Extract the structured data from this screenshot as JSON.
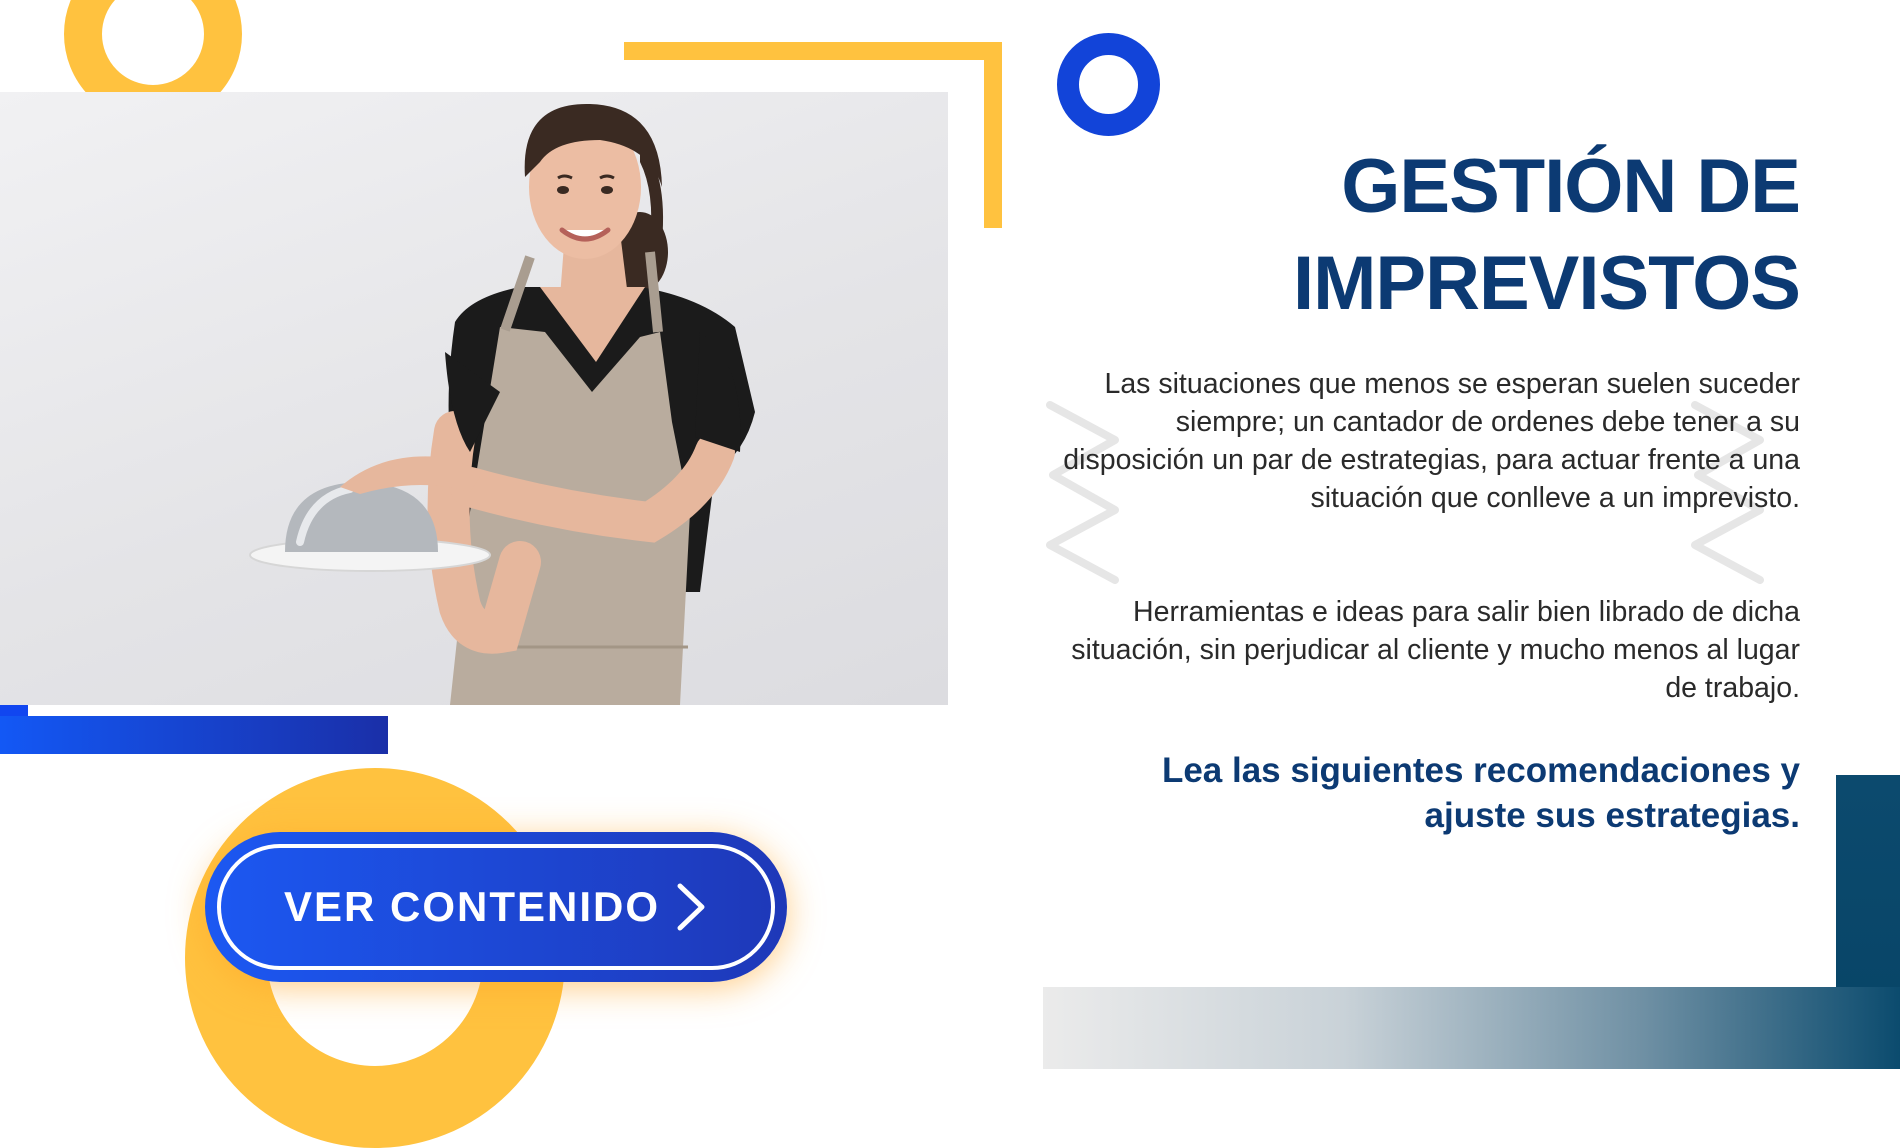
{
  "hero": {
    "title_line1": "GESTIÓN DE",
    "title_line2": "IMPREVISTOS",
    "paragraph1": "Las situaciones que menos se esperan suelen suceder siempre; un cantador de ordenes debe tener a su disposición un par de estrategias, para actuar frente a una situación que conlleve a un imprevisto.",
    "paragraph2": "Herramientas e ideas para salir bien librado de dicha situación, sin perjudicar al cliente y mucho menos al lugar de trabajo.",
    "cta_line1": "Lea las siguientes recomendaciones y",
    "cta_line2": "ajuste sus estrategias."
  },
  "button": {
    "label": "VER CONTENIDO",
    "icon": "chevron-right-icon"
  },
  "photo": {
    "subject": "waitress-with-cloche"
  },
  "colors": {
    "title": "#0c3a73",
    "body_text": "#2a2a2a",
    "accent_yellow": "#ffc23f",
    "accent_blue": "#1244d9",
    "button_start": "#1c58f2",
    "button_end": "#1e38b8",
    "teal_accent": "#0b4b6e"
  }
}
